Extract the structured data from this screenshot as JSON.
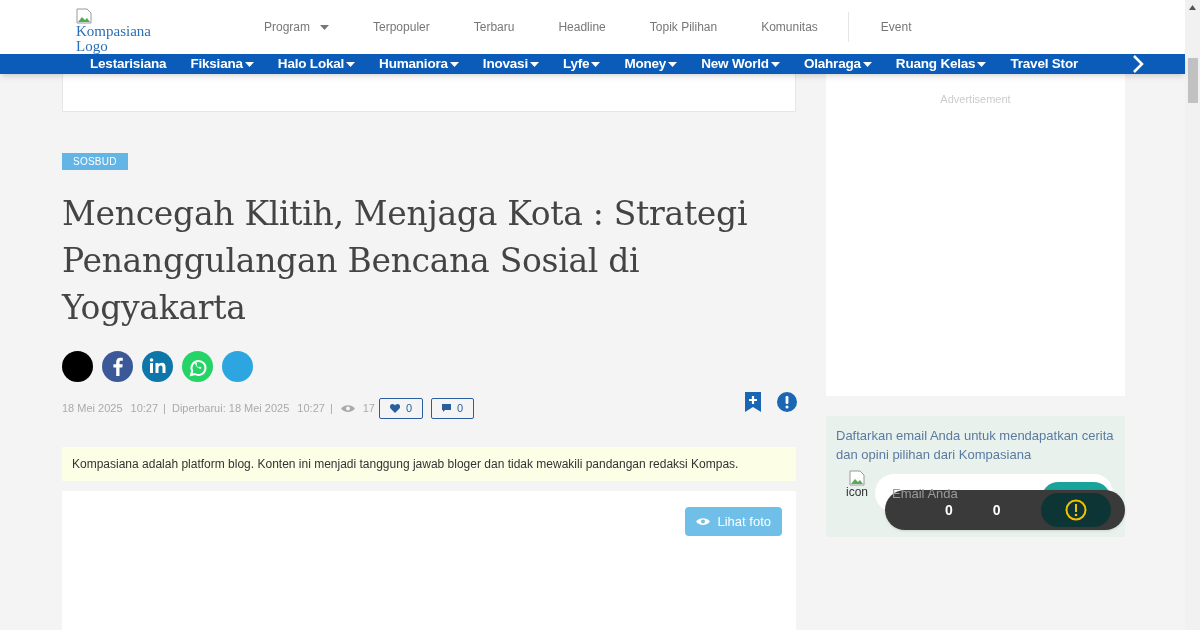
{
  "logo": {
    "alt": "Kompasiana Logo"
  },
  "top_menu": [
    {
      "label": "Program",
      "dropdown": true
    },
    {
      "label": "Terpopuler",
      "dropdown": false
    },
    {
      "label": "Terbaru",
      "dropdown": false
    },
    {
      "label": "Headline",
      "dropdown": false
    },
    {
      "label": "Topik Pilihan",
      "dropdown": false
    },
    {
      "label": "Komunitas",
      "dropdown": false
    },
    {
      "label": "Event",
      "dropdown": false
    }
  ],
  "category_nav": [
    {
      "label": "Lestarisiana",
      "dropdown": false
    },
    {
      "label": "Fiksiana",
      "dropdown": true
    },
    {
      "label": "Halo Lokal",
      "dropdown": true
    },
    {
      "label": "Humaniora",
      "dropdown": true
    },
    {
      "label": "Inovasi",
      "dropdown": true
    },
    {
      "label": "Lyfe",
      "dropdown": true
    },
    {
      "label": "Money",
      "dropdown": true
    },
    {
      "label": "New World",
      "dropdown": true
    },
    {
      "label": "Olahraga",
      "dropdown": true
    },
    {
      "label": "Ruang Kelas",
      "dropdown": true
    },
    {
      "label": "Travel Stor",
      "dropdown": false
    }
  ],
  "article": {
    "tag": "SOSBUD",
    "title": "Mencegah Klitih, Menjaga Kota : Strategi Penanggulangan Bencana Sosial di Yogyakarta",
    "share": [
      {
        "kind": "x"
      },
      {
        "kind": "facebook"
      },
      {
        "kind": "linkedin"
      },
      {
        "kind": "whatsapp"
      },
      {
        "kind": "telegram"
      }
    ],
    "published": "18 Mei 2025",
    "published_time": "10:27",
    "separators": [
      "|",
      "|"
    ],
    "updated": "Diperbarui: 18 Mei 2025",
    "updated_time": "10:27",
    "views": "17",
    "likes": "0",
    "comments": "0",
    "disclaimer": "Kompasiana adalah platform blog. Konten ini menjadi tanggung jawab bloger dan tidak mewakili pandangan redaksi Kompas.",
    "photo_button": "Lihat foto"
  },
  "sidebar": {
    "ad_label": "Advertisement",
    "subscribe": {
      "text": "Daftarkan email Anda untuk mendapatkan cerita dan opini pilihan dari Kompasiana",
      "icon_alt": "icon",
      "placeholder": "Email Anda"
    }
  },
  "overlay": {
    "counts": [
      "0",
      "0"
    ]
  }
}
